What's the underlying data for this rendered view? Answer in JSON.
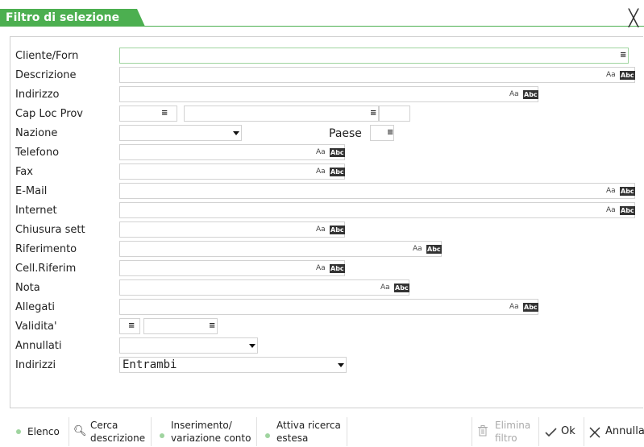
{
  "window": {
    "title": "Filtro di selezione",
    "close_icon": "close-icon"
  },
  "form": {
    "cliente_forn": {
      "label": "Cliente/Forn",
      "value": ""
    },
    "descrizione": {
      "label": "Descrizione",
      "value": ""
    },
    "indirizzo": {
      "label": "Indirizzo",
      "value": ""
    },
    "cap_loc_prov": {
      "label": "Cap Loc Prov",
      "cap": "",
      "loc": "",
      "prov": ""
    },
    "nazione": {
      "label": "Nazione",
      "value": ""
    },
    "paese": {
      "label": "Paese",
      "value": ""
    },
    "telefono": {
      "label": "Telefono",
      "value": ""
    },
    "fax": {
      "label": "Fax",
      "value": ""
    },
    "email": {
      "label": "E-Mail",
      "value": ""
    },
    "internet": {
      "label": "Internet",
      "value": ""
    },
    "chiusura_sett": {
      "label": "Chiusura sett",
      "value": ""
    },
    "riferimento": {
      "label": "Riferimento",
      "value": ""
    },
    "cell_riferim": {
      "label": "Cell.Riferim",
      "value": ""
    },
    "nota": {
      "label": "Nota",
      "value": ""
    },
    "allegati": {
      "label": "Allegati",
      "value": ""
    },
    "validita": {
      "label": "Validita'",
      "from": "",
      "to": ""
    },
    "annullati": {
      "label": "Annullati",
      "value": ""
    },
    "indirizzi": {
      "label": "Indirizzi",
      "value": "Entrambi"
    }
  },
  "icons": {
    "abc": "Abc",
    "case": "Aa"
  },
  "toolbar": {
    "elenco": "Elenco",
    "cerca_1": "Cerca",
    "cerca_2": "descrizione",
    "inserimento_1": "Inserimento/",
    "inserimento_2": "variazione conto",
    "attiva_1": "Attiva ricerca",
    "attiva_2": "estesa",
    "elimina_1": "Elimina",
    "elimina_2": "filtro",
    "ok": "Ok",
    "annulla": "Annulla"
  },
  "colors": {
    "accent": "#4caf50",
    "dot": "#9fd49f"
  }
}
